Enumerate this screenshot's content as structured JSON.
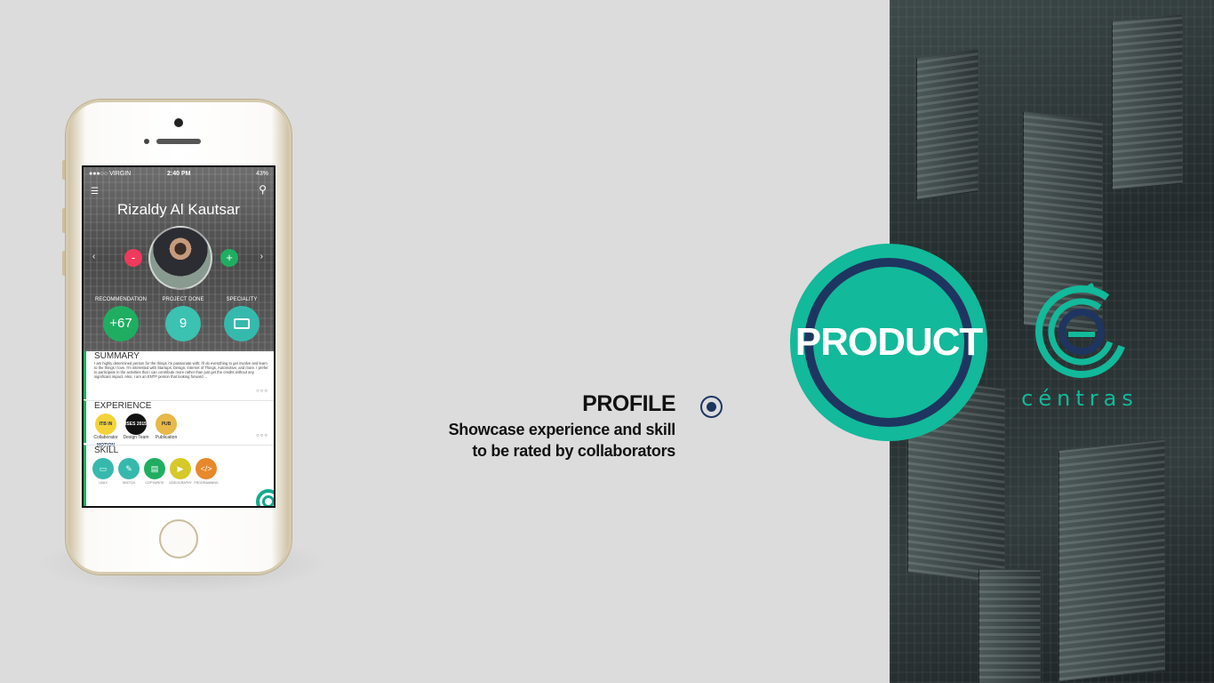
{
  "brand": {
    "name": "céntras",
    "accent_color": "#12b99a",
    "navy_color": "#1e3560"
  },
  "badge": {
    "label": "PRODUCT"
  },
  "feature": {
    "title": "PROFILE",
    "description_line1": "Showcase experience and skill",
    "description_line2": "to be rated by collaborators"
  },
  "phone": {
    "status": {
      "carrier": "●●●○○ VIRGIN",
      "time": "2:40 PM",
      "battery": "43%"
    },
    "profile": {
      "name": "Rizaldy Al Kautsar",
      "minus": "-",
      "plus": "+",
      "prev": "‹",
      "next": "›"
    },
    "stats": [
      {
        "label": "RECOMMENDATION",
        "value": "+67"
      },
      {
        "label": "PROJECT DONE",
        "value": "9"
      },
      {
        "label": "SPECIALITY",
        "icon": "monitor-icon"
      }
    ],
    "summary": {
      "title": "SUMMARY",
      "text": "I am highly determined person for the things i'm passionate with; i'll do everything to get involve and learn to the things I love. I'm interested with Startups, Design, Internet of Things, Automotive, and more. I prefer to participate in the activities that i can contribute more rather than just get the credits without any significant impact. Also, I am an ENTP person that looking forward ..."
    },
    "experience": {
      "title": "EXPERIENCE",
      "items": [
        {
          "logo_text": "ITB IN MOTION",
          "label": "Collaborator"
        },
        {
          "logo_text": "ISES 2015",
          "label": "Design Team"
        },
        {
          "logo_text": "PUB",
          "label": "Publication"
        }
      ]
    },
    "skill": {
      "title": "SKILL",
      "items": [
        {
          "label": "UI/UX",
          "icon": "monitor-icon",
          "color": "#36b9ad"
        },
        {
          "label": "SKETCH",
          "icon": "pen-icon",
          "color": "#36b9ad"
        },
        {
          "label": "COPYWRITE",
          "icon": "document-icon",
          "color": "#1fae61"
        },
        {
          "label": "VIDEOGRAPHY",
          "icon": "video-icon",
          "color": "#d6c92a"
        },
        {
          "label": "PROGRAMMING",
          "icon": "code-icon",
          "color": "#e7882b"
        }
      ]
    },
    "more_dots": "○○○"
  }
}
